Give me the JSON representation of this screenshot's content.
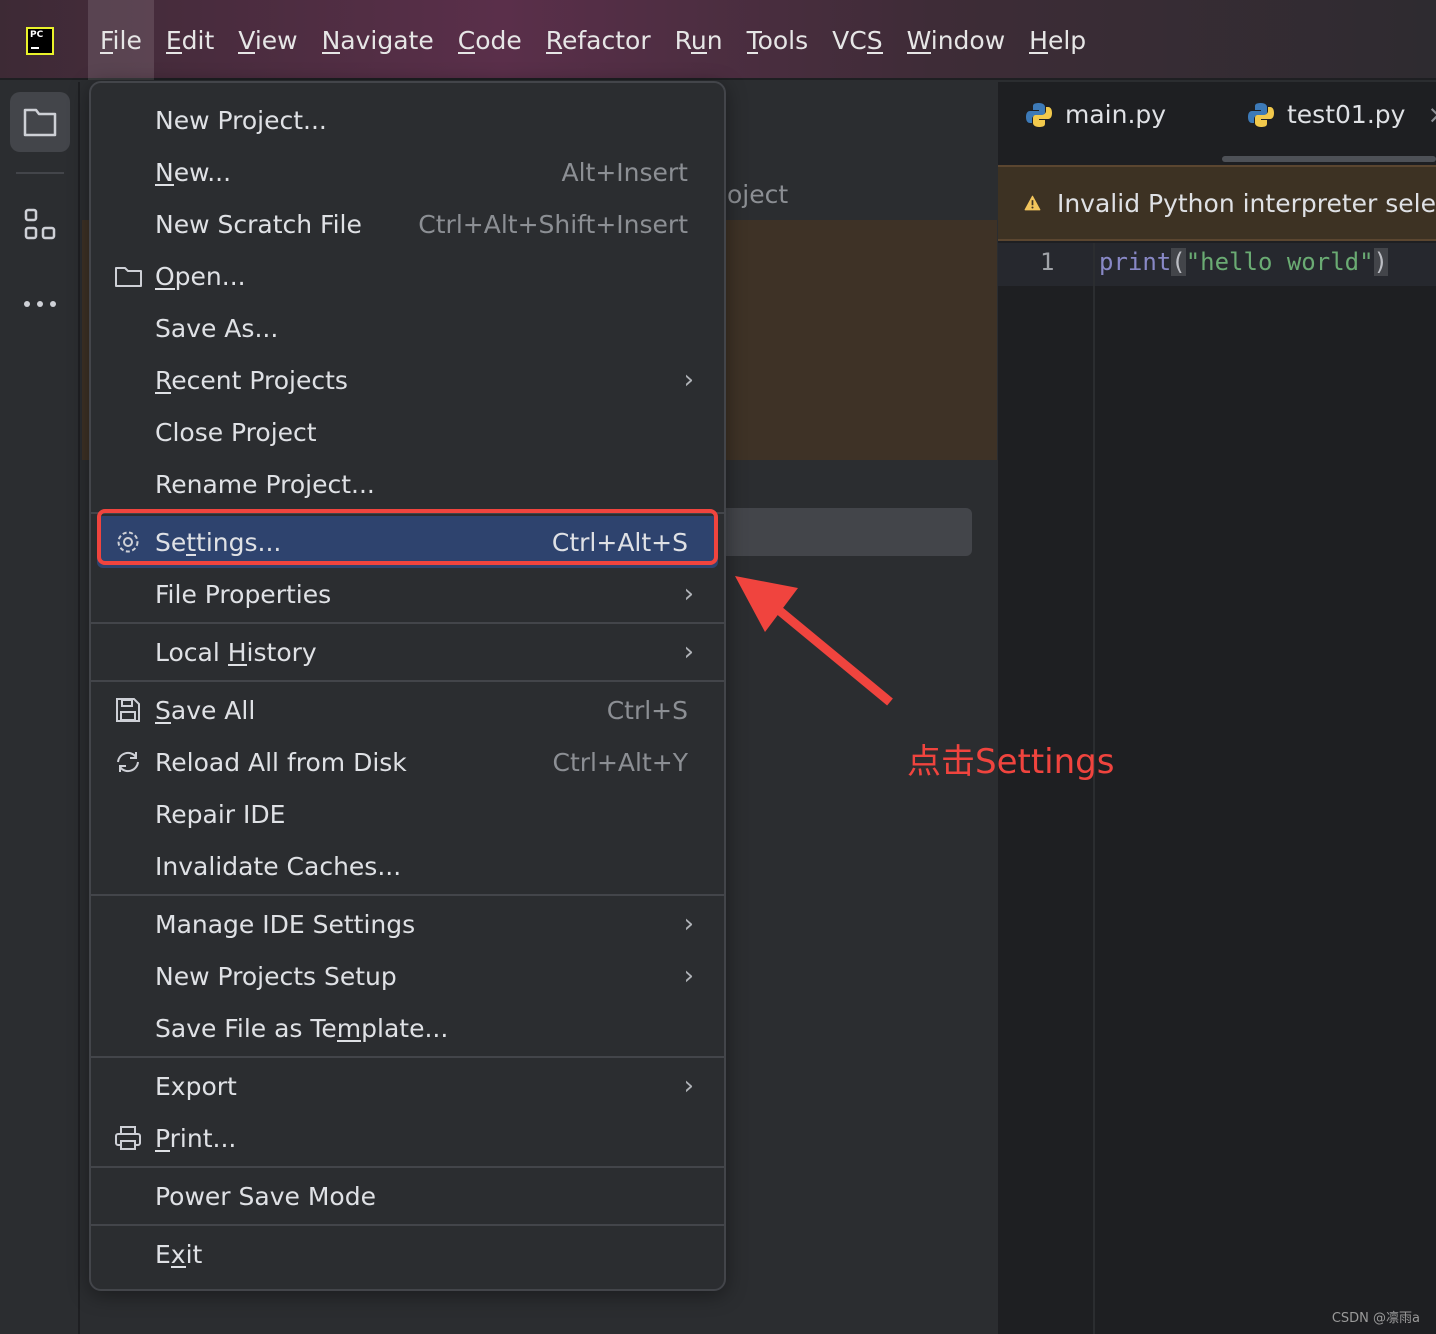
{
  "menubar": {
    "items": [
      {
        "label": "File",
        "mn": 0,
        "active": true
      },
      {
        "label": "Edit",
        "mn": 0
      },
      {
        "label": "View",
        "mn": 0
      },
      {
        "label": "Navigate",
        "mn": 0
      },
      {
        "label": "Code",
        "mn": 0
      },
      {
        "label": "Refactor",
        "mn": 0
      },
      {
        "label": "Run",
        "mn": 1
      },
      {
        "label": "Tools",
        "mn": 0
      },
      {
        "label": "VCS",
        "mn": 2
      },
      {
        "label": "Window",
        "mn": 0
      },
      {
        "label": "Help",
        "mn": 0
      }
    ]
  },
  "logo": "PC",
  "project_panel": {
    "partial_title": "oject"
  },
  "editor": {
    "tabs": [
      {
        "label": "main.py",
        "icon": "python-icon"
      },
      {
        "label": "test01.py",
        "icon": "python-icon",
        "close": "×"
      }
    ],
    "banner": "Invalid Python interpreter sele",
    "line_number": "1",
    "code": {
      "fn": "print",
      "open": "(",
      "str": "\"hello world\"",
      "close": ")"
    }
  },
  "file_menu": {
    "groups": [
      [
        {
          "label": "New Project...",
          "mn": -1
        },
        {
          "label": "New...",
          "mn": 0,
          "shortcut": "Alt+Insert"
        },
        {
          "label": "New Scratch File",
          "mn": -1,
          "shortcut": "Ctrl+Alt+Shift+Insert"
        },
        {
          "label": "Open...",
          "mn": 0,
          "icon": "folder-icon"
        },
        {
          "label": "Save As...",
          "mn": -1
        },
        {
          "label": "Recent Projects",
          "mn": 0,
          "submenu": true
        },
        {
          "label": "Close Project",
          "mn": -1
        },
        {
          "label": "Rename Project...",
          "mn": -1
        }
      ],
      [
        {
          "label": "Settings...",
          "mn": 2,
          "shortcut": "Ctrl+Alt+S",
          "icon": "gear-icon",
          "highlighted": true
        },
        {
          "label": "File Properties",
          "mn": -1,
          "submenu": true
        }
      ],
      [
        {
          "label": "Local History",
          "mn": 6,
          "submenu": true
        }
      ],
      [
        {
          "label": "Save All",
          "mn": 0,
          "shortcut": "Ctrl+S",
          "icon": "save-icon"
        },
        {
          "label": "Reload All from Disk",
          "mn": -1,
          "shortcut": "Ctrl+Alt+Y",
          "icon": "reload-icon"
        },
        {
          "label": "Repair IDE",
          "mn": -1
        },
        {
          "label": "Invalidate Caches...",
          "mn": -1
        }
      ],
      [
        {
          "label": "Manage IDE Settings",
          "mn": -1,
          "submenu": true
        },
        {
          "label": "New Projects Setup",
          "mn": -1,
          "submenu": true
        },
        {
          "label": "Save File as Template...",
          "mn": 15
        }
      ],
      [
        {
          "label": "Export",
          "mn": -1,
          "submenu": true
        },
        {
          "label": "Print...",
          "mn": 0,
          "icon": "print-icon"
        }
      ],
      [
        {
          "label": "Power Save Mode",
          "mn": -1
        }
      ],
      [
        {
          "label": "Exit",
          "mn": 1
        }
      ]
    ]
  },
  "annotation": {
    "text": "点击Settings",
    "color": "#f0443e"
  },
  "watermark": "CSDN @凛雨a"
}
